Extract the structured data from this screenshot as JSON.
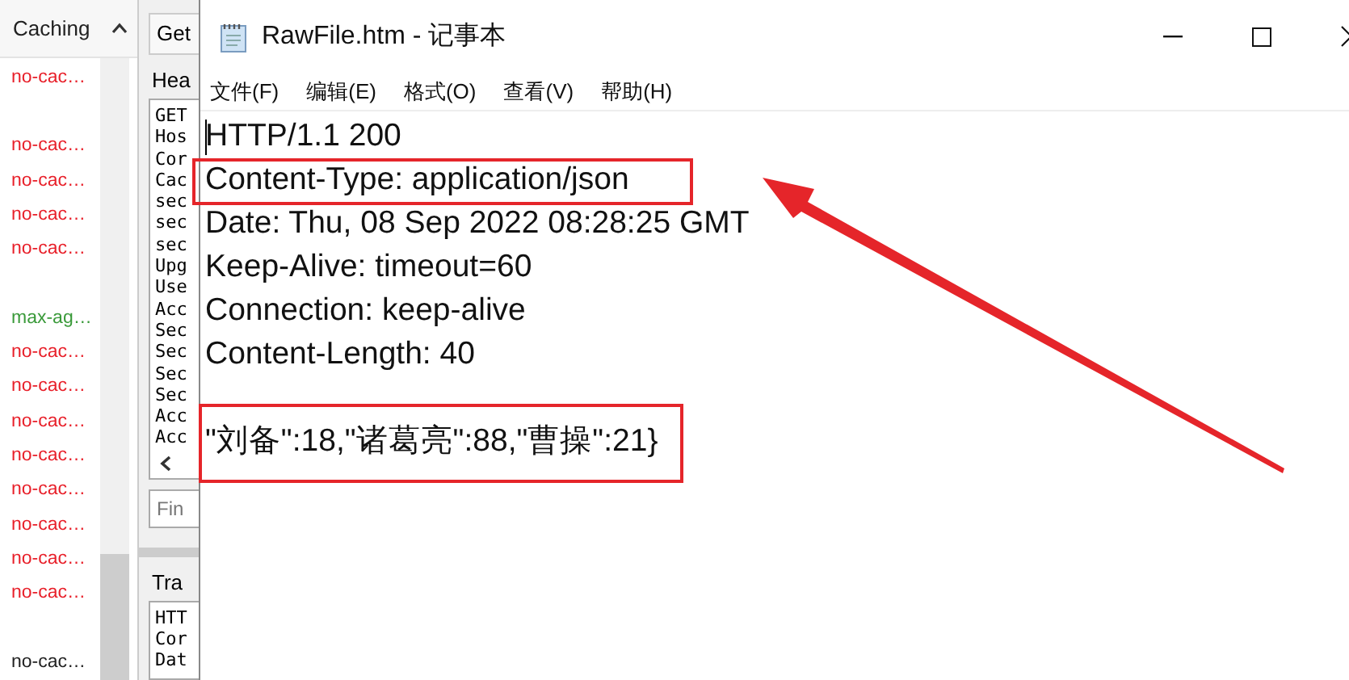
{
  "caching_column": {
    "header": "Caching",
    "rows": [
      {
        "kind": "value",
        "text": "no-cac…",
        "color": "#e8202a"
      },
      {
        "kind": "empty"
      },
      {
        "kind": "value",
        "text": "no-cac…",
        "color": "#e8202a"
      },
      {
        "kind": "value",
        "text": "no-cac…",
        "color": "#e8202a"
      },
      {
        "kind": "value",
        "text": "no-cac…",
        "color": "#e8202a"
      },
      {
        "kind": "value",
        "text": "no-cac…",
        "color": "#e8202a"
      },
      {
        "kind": "empty"
      },
      {
        "kind": "value",
        "text": "max-ag…",
        "color": "#3a9a3a"
      },
      {
        "kind": "value",
        "text": "no-cac…",
        "color": "#e8202a"
      },
      {
        "kind": "value",
        "text": "no-cac…",
        "color": "#e8202a"
      },
      {
        "kind": "value",
        "text": "no-cac…",
        "color": "#e8202a"
      },
      {
        "kind": "value",
        "text": "no-cac…",
        "color": "#e8202a"
      },
      {
        "kind": "value",
        "text": "no-cac…",
        "color": "#e8202a"
      },
      {
        "kind": "value",
        "text": "no-cac…",
        "color": "#e8202a"
      },
      {
        "kind": "value",
        "text": "no-cac…",
        "color": "#e8202a"
      },
      {
        "kind": "value",
        "text": "no-cac…",
        "color": "#e8202a"
      },
      {
        "kind": "empty"
      },
      {
        "kind": "value",
        "text": "no-cac…",
        "color": "#222222"
      }
    ]
  },
  "inspector": {
    "tab": "Get",
    "headers_label": "Hea",
    "headers_lines": [
      "GET",
      "Hos",
      "Cor",
      "Cac",
      "sec",
      "sec",
      "sec",
      "Upg",
      "Use",
      "Acc",
      "Sec",
      "Sec",
      "Sec",
      "Sec",
      "Acc",
      "Acc"
    ],
    "find_placeholder": "Fin",
    "transformer_label": "Tra",
    "response_lines": [
      "HTT",
      "Cor",
      "Dat"
    ]
  },
  "notepad": {
    "title": "RawFile.htm - 记事本",
    "menu": [
      "文件(F)",
      "编辑(E)",
      "格式(O)",
      "查看(V)",
      "帮助(H)"
    ],
    "lines": [
      {
        "kind": "text",
        "text": "HTTP/1.1 200",
        "highlighted": false
      },
      {
        "kind": "text",
        "text": "Content-Type: application/json",
        "highlighted": true
      },
      {
        "kind": "text",
        "text": "Date: Thu, 08 Sep 2022 08:28:25 GMT",
        "highlighted": false
      },
      {
        "kind": "text",
        "text": "Keep-Alive: timeout=60",
        "highlighted": false
      },
      {
        "kind": "text",
        "text": "Connection: keep-alive",
        "highlighted": false
      },
      {
        "kind": "text",
        "text": "Content-Length: 40",
        "highlighted": false
      },
      {
        "kind": "empty"
      },
      {
        "kind": "text",
        "text": "\"刘备\":18,\"诸葛亮\":88,\"曹操\":21}",
        "highlighted": true
      }
    ]
  }
}
